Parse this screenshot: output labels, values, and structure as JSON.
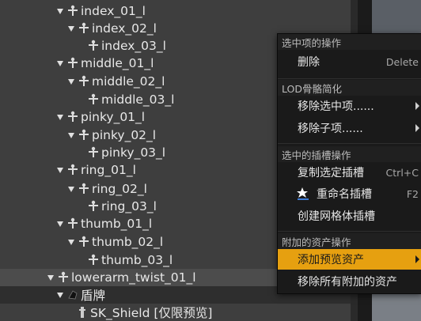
{
  "tree": {
    "rows": [
      {
        "label": "index_01_l"
      },
      {
        "label": "index_02_l"
      },
      {
        "label": "index_03_l"
      },
      {
        "label": "middle_01_l"
      },
      {
        "label": "middle_02_l"
      },
      {
        "label": "middle_03_l"
      },
      {
        "label": "pinky_01_l"
      },
      {
        "label": "pinky_02_l"
      },
      {
        "label": "pinky_03_l"
      },
      {
        "label": "ring_01_l"
      },
      {
        "label": "ring_02_l"
      },
      {
        "label": "ring_03_l"
      },
      {
        "label": "thumb_01_l"
      },
      {
        "label": "thumb_02_l"
      },
      {
        "label": "thumb_03_l"
      },
      {
        "label": "lowerarm_twist_01_l"
      },
      {
        "label": "盾牌"
      },
      {
        "label": "SK_Shield [仅限预览]"
      }
    ]
  },
  "menu": {
    "sections": {
      "selected_ops": "选中项的操作",
      "lod": "LOD骨骼简化",
      "socket_ops": "选中的插槽操作",
      "attached_ops": "附加的资产操作"
    },
    "items": {
      "delete": {
        "label": "删除",
        "shortcut": "Delete"
      },
      "remove_selected": {
        "label": "移除选中项......"
      },
      "remove_children": {
        "label": "移除子项......"
      },
      "copy_socket": {
        "label": "复制选定插槽",
        "shortcut": "Ctrl+C"
      },
      "rename_socket": {
        "label": "重命名插槽",
        "shortcut": "F2"
      },
      "create_mesh_socket": {
        "label": "创建网格体插槽"
      },
      "add_preview_asset": {
        "label": "添加预览资产"
      },
      "remove_all_attached": {
        "label": "移除所有附加的资产"
      }
    }
  }
}
